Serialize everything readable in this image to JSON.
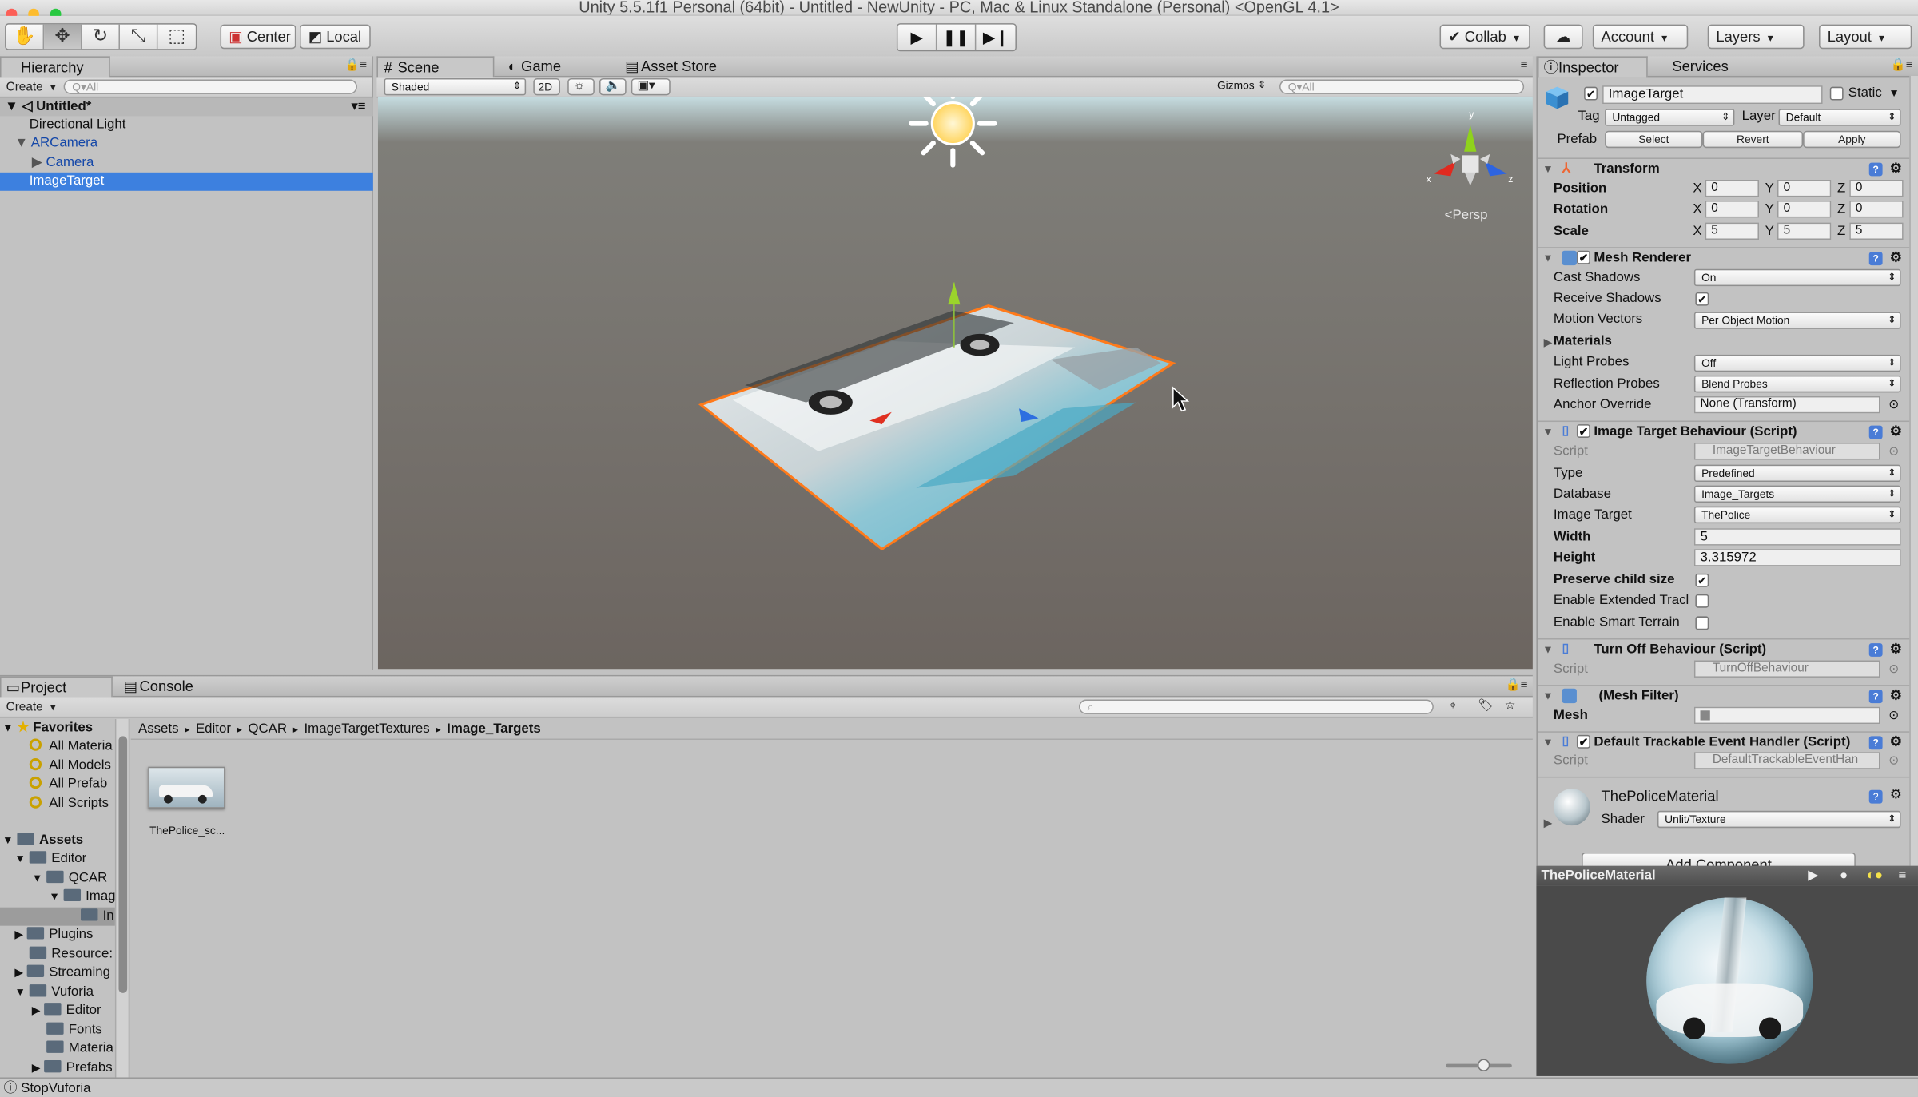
{
  "window": {
    "title": "Unity 5.5.1f1 Personal (64bit) - Untitled - NewUnity - PC, Mac & Linux Standalone (Personal) <OpenGL 4.1>"
  },
  "toolbar": {
    "pivot_center": "Center",
    "pivot_local": "Local",
    "collab": "Collab",
    "account": "Account",
    "layers": "Layers",
    "layout": "Layout"
  },
  "hierarchy": {
    "tab": "Hierarchy",
    "create": "Create",
    "search_placeholder": "Q▾All",
    "scene": "Untitled*",
    "items": [
      {
        "label": "Directional Light"
      },
      {
        "label": "ARCamera"
      },
      {
        "label": "Camera"
      },
      {
        "label": "ImageTarget"
      }
    ]
  },
  "scene_view": {
    "tabs": [
      {
        "label": "Scene"
      },
      {
        "label": "Game"
      },
      {
        "label": "Asset Store"
      }
    ],
    "shading": "Shaded",
    "mode_2d": "2D",
    "gizmos": "Gizmos",
    "search_placeholder": "Q▾All",
    "persp": "Persp",
    "axis_x": "x",
    "axis_y": "y",
    "axis_z": "z"
  },
  "project": {
    "tabs": [
      {
        "label": "Project"
      },
      {
        "label": "Console"
      }
    ],
    "create": "Create",
    "favorites": {
      "label": "Favorites",
      "items": [
        "All Materia",
        "All Models",
        "All Prefab",
        "All Scripts"
      ]
    },
    "assets": {
      "label": "Assets",
      "tree": [
        "Editor",
        "QCAR",
        "Imag",
        "In",
        "Plugins",
        "Resource:",
        "Streaming",
        "Vuforia",
        "Editor",
        "Fonts",
        "Materia",
        "Prefabs"
      ]
    },
    "breadcrumb": [
      "Assets",
      "Editor",
      "QCAR",
      "ImageTargetTextures",
      "Image_Targets"
    ],
    "asset_item": "ThePolice_sc..."
  },
  "status": {
    "message": "StopVuforia"
  },
  "inspector": {
    "tabs": [
      {
        "label": "Inspector"
      },
      {
        "label": "Services"
      }
    ],
    "object_name": "ImageTarget",
    "static_label": "Static",
    "tag_label": "Tag",
    "tag_value": "Untagged",
    "layer_label": "Layer",
    "layer_value": "Default",
    "prefab_label": "Prefab",
    "prefab_select": "Select",
    "prefab_revert": "Revert",
    "prefab_apply": "Apply",
    "transform": {
      "title": "Transform",
      "position": "Position",
      "rotation": "Rotation",
      "scale": "Scale",
      "x": "X",
      "y": "Y",
      "z": "Z",
      "pos": [
        "0",
        "0",
        "0"
      ],
      "rot": [
        "0",
        "0",
        "0"
      ],
      "scl": [
        "5",
        "5",
        "5"
      ]
    },
    "mesh_renderer": {
      "title": "Mesh Renderer",
      "cast_shadows": "Cast Shadows",
      "cast_shadows_value": "On",
      "receive_shadows": "Receive Shadows",
      "motion_vectors": "Motion Vectors",
      "motion_vectors_value": "Per Object Motion",
      "materials": "Materials",
      "light_probes": "Light Probes",
      "light_probes_value": "Off",
      "reflection_probes": "Reflection Probes",
      "reflection_probes_value": "Blend Probes",
      "anchor_override": "Anchor Override",
      "anchor_override_value": "None (Transform)"
    },
    "image_target": {
      "title": "Image Target Behaviour (Script)",
      "script": "Script",
      "script_value": "ImageTargetBehaviour",
      "type": "Type",
      "type_value": "Predefined",
      "database": "Database",
      "database_value": "Image_Targets",
      "image_target": "Image Target",
      "image_target_value": "ThePolice",
      "width": "Width",
      "width_value": "5",
      "height": "Height",
      "height_value": "3.315972",
      "preserve": "Preserve child size",
      "extended": "Enable Extended Tracl",
      "smart": "Enable Smart Terrain"
    },
    "turn_off": {
      "title": "Turn Off Behaviour (Script)",
      "script": "Script",
      "script_value": "TurnOffBehaviour"
    },
    "mesh_filter": {
      "title": "(Mesh Filter)",
      "mesh": "Mesh"
    },
    "trackable": {
      "title": "Default Trackable Event Handler (Script)",
      "script": "Script",
      "script_value": "DefaultTrackableEventHan"
    },
    "material": {
      "name": "ThePoliceMaterial",
      "shader_label": "Shader",
      "shader_value": "Unlit/Texture"
    },
    "add_component": "Add Component",
    "preview_title": "ThePoliceMaterial"
  }
}
